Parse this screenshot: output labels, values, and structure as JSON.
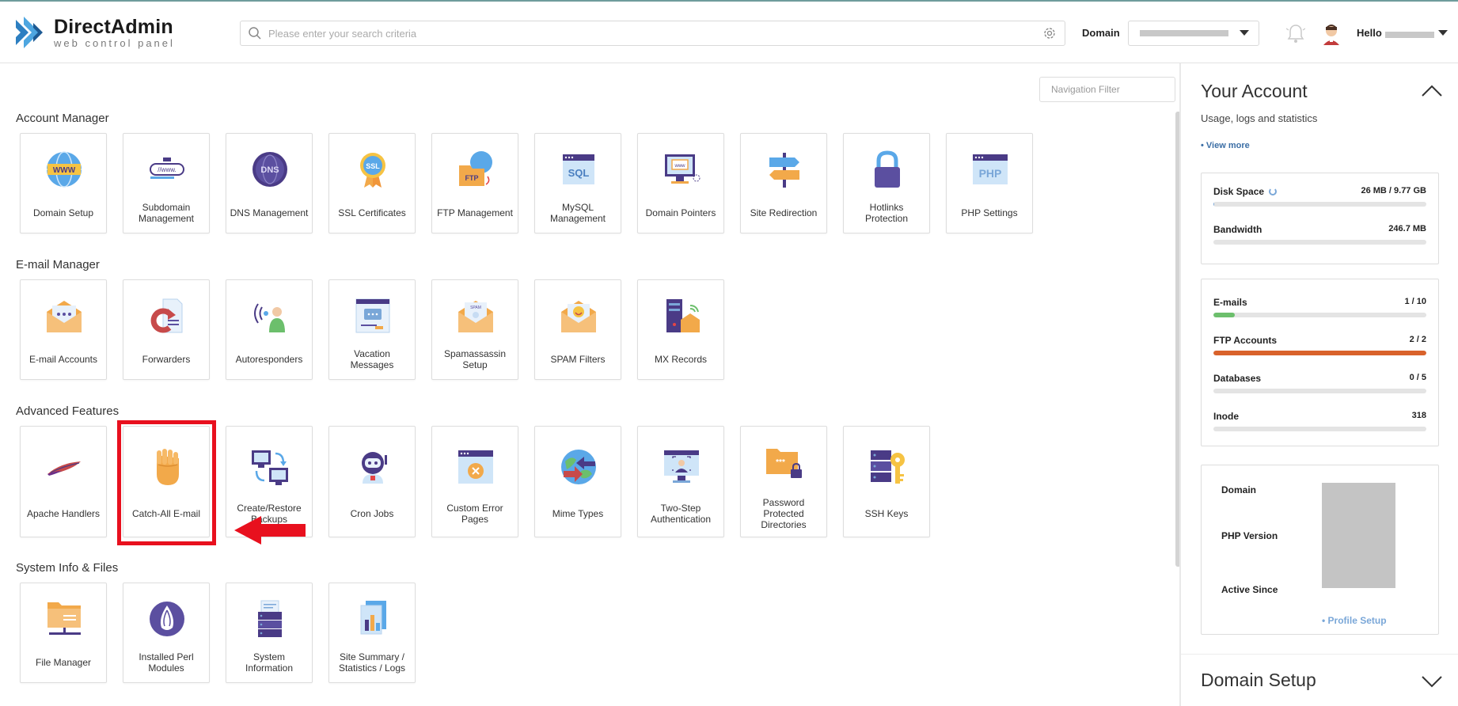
{
  "header": {
    "logo_title": "DirectAdmin",
    "logo_subtitle": "web control panel",
    "search_placeholder": "Please enter your search criteria",
    "domain_label": "Domain",
    "hello_label": "Hello"
  },
  "nav_filter": {
    "placeholder": "Navigation Filter"
  },
  "sections": {
    "account": {
      "title": "Account Manager",
      "items": [
        "Domain Setup",
        "Subdomain Management",
        "DNS Management",
        "SSL Certificates",
        "FTP Management",
        "MySQL Management",
        "Domain Pointers",
        "Site Redirection",
        "Hotlinks Protection",
        "PHP Settings"
      ]
    },
    "email": {
      "title": "E-mail Manager",
      "items": [
        "E-mail Accounts",
        "Forwarders",
        "Autoresponders",
        "Vacation Messages",
        "Spamassassin Setup",
        "SPAM Filters",
        "MX Records"
      ]
    },
    "advanced": {
      "title": "Advanced Features",
      "items": [
        "Apache Handlers",
        "Catch-All E-mail",
        "Create/Restore Backups",
        "Cron Jobs",
        "Custom Error Pages",
        "Mime Types",
        "Two-Step Authentication",
        "Password Protected Directories",
        "SSH Keys"
      ]
    },
    "system": {
      "title": "System Info & Files",
      "items": [
        "File Manager",
        "Installed Perl Modules",
        "System Information",
        "Site Summary / Statistics / Logs"
      ]
    }
  },
  "account_panel": {
    "title": "Your Account",
    "subtitle": "Usage, logs and statistics",
    "view_more": "• View more",
    "stats_a": [
      {
        "name": "Disk Space",
        "value": "26 MB / 9.77 GB",
        "fraction": 0.003,
        "color": "#7aa7d8"
      },
      {
        "name": "Bandwidth",
        "value": "246.7 MB",
        "fraction": 0,
        "color": "#7aa7d8"
      }
    ],
    "stats_b": [
      {
        "name": "E-mails",
        "value": "1 / 10",
        "fraction": 0.1,
        "color": "#6cbf6c"
      },
      {
        "name": "FTP Accounts",
        "value": "2 / 2",
        "fraction": 1.0,
        "color": "#d9622b"
      },
      {
        "name": "Databases",
        "value": "0 / 5",
        "fraction": 0,
        "color": "#7aa7d8"
      },
      {
        "name": "Inode",
        "value": "318",
        "fraction": 0,
        "color": "#7aa7d8"
      }
    ],
    "info": {
      "domain_label": "Domain",
      "php_label": "PHP Version",
      "active_label": "Active Since",
      "profile_link": "• Profile Setup"
    },
    "domain_setup_title": "Domain Setup"
  },
  "colors": {
    "highlight": "#e8101e",
    "accent": "#3b6ea5",
    "ftp_bar": "#d9622b",
    "email_bar": "#6cbf6c"
  }
}
